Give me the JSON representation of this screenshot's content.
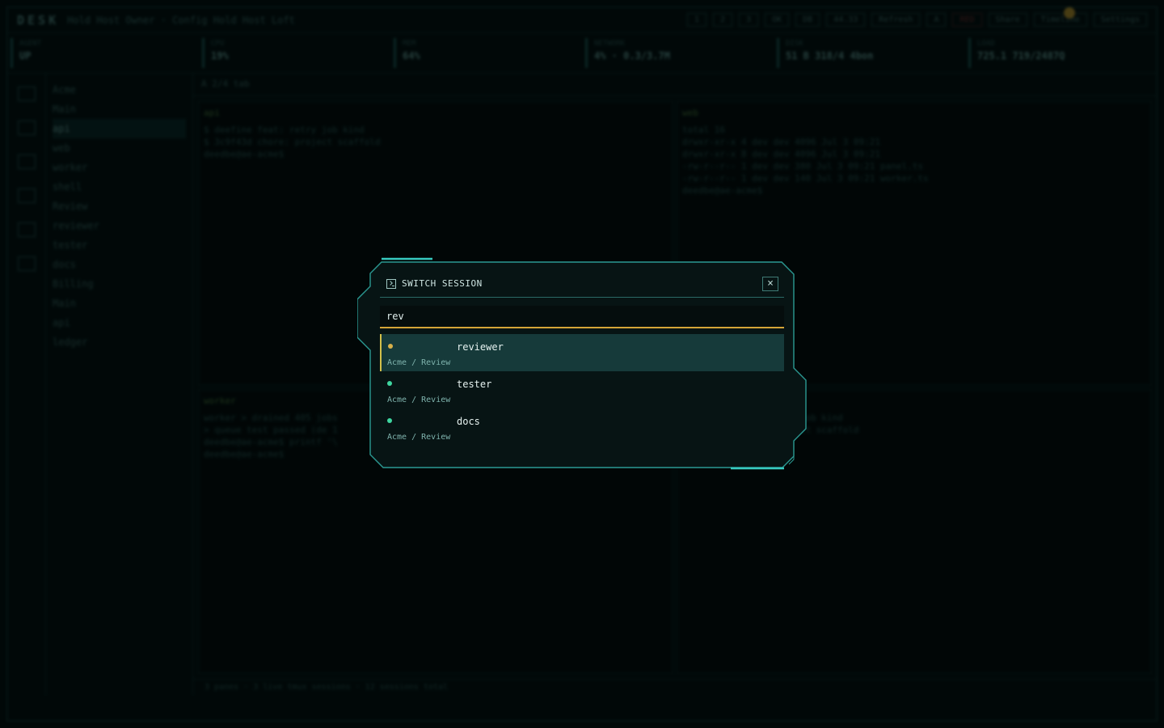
{
  "background": {
    "brand": "DESK",
    "breadcrumb": "Hold Host Owner · Config Hold Host Loft",
    "top_chips": [
      "1",
      "2",
      "3",
      "OK",
      "DB",
      "44.33",
      "Refresh",
      "A",
      "RED",
      "Share",
      "Timeline",
      "Settings"
    ],
    "stats": [
      {
        "label": "AGENT",
        "value": "UP"
      },
      {
        "label": "CPU",
        "value": "19%"
      },
      {
        "label": "MEM",
        "value": "64%"
      },
      {
        "label": "NETWORK",
        "value": "4% · 0.3/3.7M"
      },
      {
        "label": "DISK",
        "value": "51 B 318/4 4bon"
      },
      {
        "label": "LOAD",
        "value": "725.1 719/2487Q"
      }
    ],
    "tree": [
      {
        "label": "Acme",
        "hi": false
      },
      {
        "label": "Main",
        "hi": false
      },
      {
        "label": "api",
        "hi": true
      },
      {
        "label": "web",
        "hi": false
      },
      {
        "label": "worker",
        "hi": false
      },
      {
        "label": "shell",
        "hi": false
      },
      {
        "label": "Review",
        "hi": false
      },
      {
        "label": "reviewer",
        "hi": false
      },
      {
        "label": "tester",
        "hi": false
      },
      {
        "label": "docs",
        "hi": false
      },
      {
        "label": "Billing",
        "hi": false
      },
      {
        "label": "Main",
        "hi": false
      },
      {
        "label": "api",
        "hi": false
      },
      {
        "label": "ledger",
        "hi": false
      }
    ],
    "main_head": "A 2/4 tab",
    "panes": [
      {
        "head": "api",
        "lines": [
          "$ deefine feat: retry job kind",
          "$ 3c9f43d chore: project scaffold",
          "deedbe@ae-acme$"
        ]
      },
      {
        "head": "web",
        "lines": [
          "total 16",
          "drwxr-xr-x 4 dev dev 4096 Jul 3 09:21",
          "drwxr-xr-x 8 dev dev 4096 Jul 3 09:21",
          "-rw-r--r-- 1 dev dev 380 Jul 3 09:21 panel.ts",
          "-rw-r--r-- 1 dev dev 140 Jul 3 09:21 worker.ts",
          "deedbe@ae-acme$"
        ]
      },
      {
        "head": "worker",
        "lines": [
          "worker > drained 405 jobs",
          "> queue test passed (de 1",
          "deedbe@ae-acme$ printf '\\",
          "deedbe@ae-acme$"
        ]
      },
      {
        "head": "shell",
        "lines": [
          "$ deefine feat: retry job kind",
          "$ 3c9f43d chore: project scaffold"
        ]
      }
    ],
    "statusbar": "3 panes · 3 live tmux sessions · 12 sessions total"
  },
  "modal": {
    "title": "SWITCH SESSION",
    "close_label": "×",
    "search_value": "rev",
    "results": [
      {
        "name": "reviewer",
        "path": "Acme / Review",
        "status_color": "#d8b04a",
        "active": true
      },
      {
        "name": "tester",
        "path": "Acme / Review",
        "status_color": "#3fd6a0",
        "active": false
      },
      {
        "name": "docs",
        "path": "Acme / Review",
        "status_color": "#3fd6a0",
        "active": false
      }
    ]
  }
}
